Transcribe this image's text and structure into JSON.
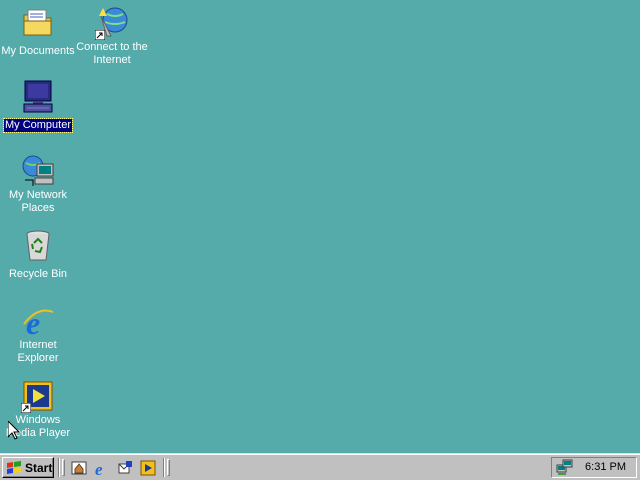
{
  "desktop": {
    "background_color": "#55aaaa",
    "icons": [
      {
        "id": "my-documents",
        "label": "My Documents",
        "icon": "folder-documents-icon",
        "selected": false
      },
      {
        "id": "connect-internet",
        "label": "Connect to the\nInternet",
        "icon": "connect-wizard-icon",
        "selected": false
      },
      {
        "id": "my-computer",
        "label": "My Computer",
        "icon": "computer-icon",
        "selected": true
      },
      {
        "id": "my-network-places",
        "label": "My Network\nPlaces",
        "icon": "network-icon",
        "selected": false
      },
      {
        "id": "recycle-bin",
        "label": "Recycle Bin",
        "icon": "recycle-bin-icon",
        "selected": false
      },
      {
        "id": "internet-explorer",
        "label": "Internet\nExplorer",
        "icon": "ie-icon",
        "selected": false
      },
      {
        "id": "windows-media-player",
        "label": "Windows\nMedia Player",
        "icon": "media-player-icon",
        "selected": false
      }
    ]
  },
  "taskbar": {
    "start_label": "Start",
    "quick_launch": [
      {
        "name": "show-desktop-icon"
      },
      {
        "name": "internet-explorer-icon"
      },
      {
        "name": "outlook-express-icon"
      },
      {
        "name": "media-player-icon"
      }
    ],
    "tray": {
      "clock": "6:31 PM",
      "icons": [
        "network-connection-icon"
      ]
    }
  }
}
